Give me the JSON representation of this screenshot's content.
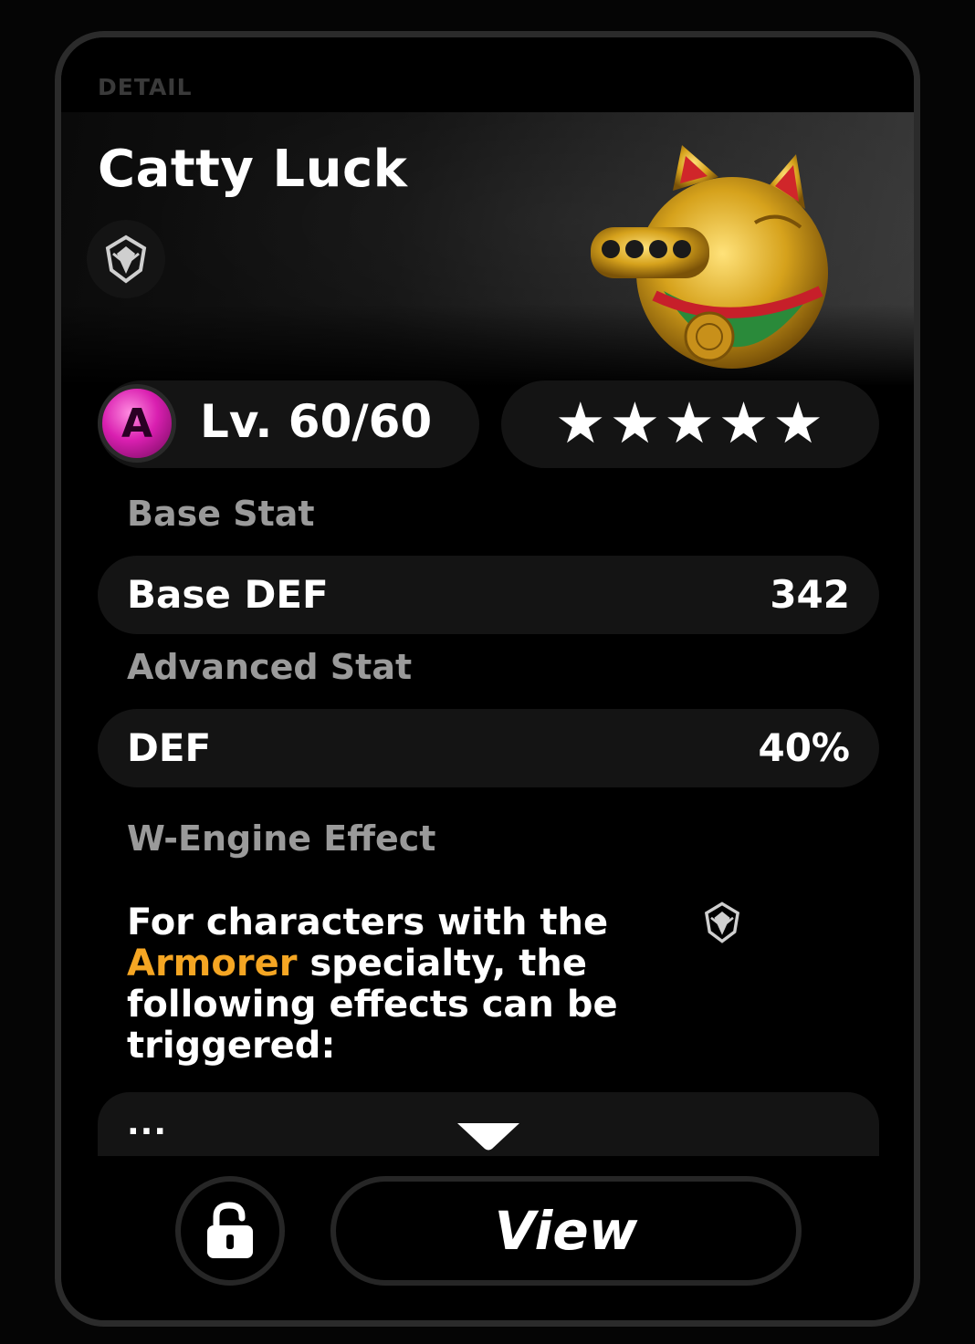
{
  "header": {
    "label": "DETAIL"
  },
  "item": {
    "name": "Catty Luck",
    "specialty_icon": "armorer-specialty-icon",
    "image_icon": "lucky-cat-artwork"
  },
  "level": {
    "rank_badge": "A",
    "text": "Lv. 60/60"
  },
  "stars": {
    "count": 5,
    "max": 5,
    "glyph": "★"
  },
  "base_stat": {
    "section_label": "Base Stat",
    "name": "Base DEF",
    "value": "342"
  },
  "advanced_stat": {
    "section_label": "Advanced Stat",
    "name": "DEF",
    "value": "40%"
  },
  "effect": {
    "section_label": "W-Engine Effect",
    "text_before": "For characters with the ",
    "highlight": "Armorer",
    "text_after": " specialty, the following effects can be triggered:",
    "more": "...",
    "icon": "armorer-specialty-icon"
  },
  "actions": {
    "lock_icon": "unlock-icon",
    "view_label": "View"
  },
  "colors": {
    "highlight": "#f5a623",
    "rank_badge": "#d91fb0",
    "panel": "#141414",
    "section_label": "#9a9a9a"
  }
}
